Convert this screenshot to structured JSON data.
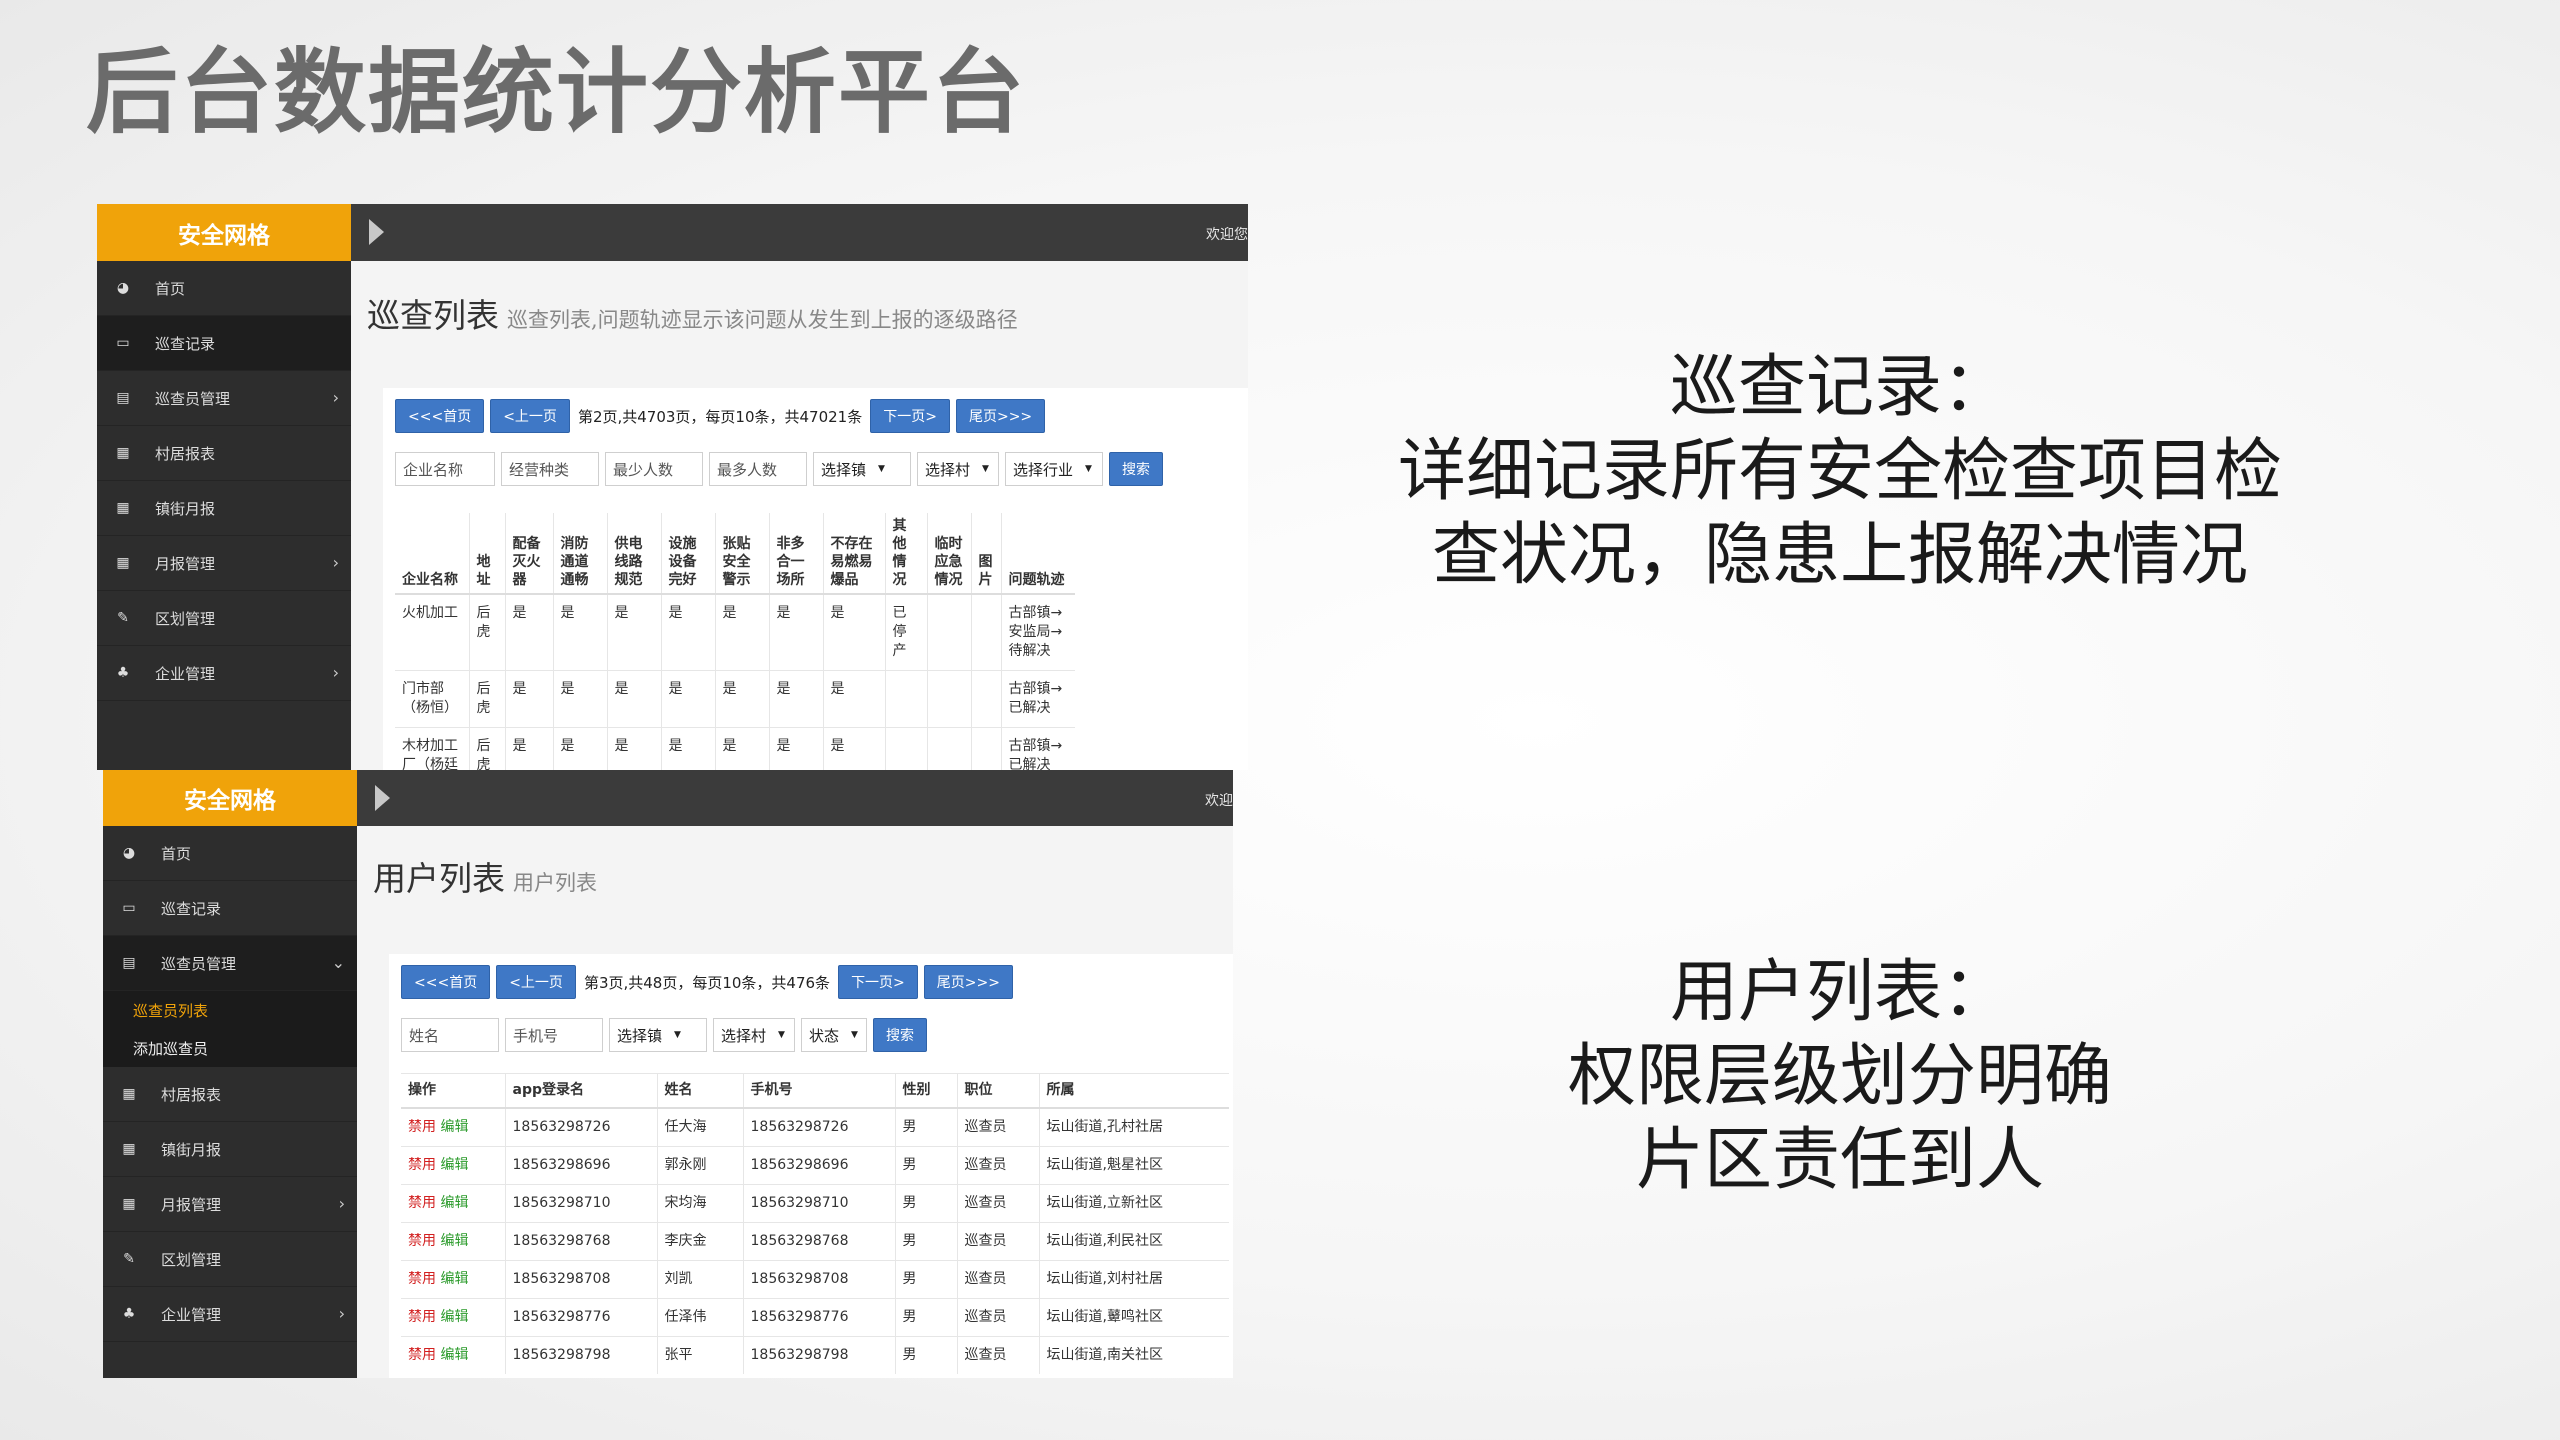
{
  "slide": {
    "title": "后台数据统计分析平台",
    "caption1": [
      "巡查记录：",
      "详细记录所有安全检查项目检",
      "查状况，隐患上报解决情况"
    ],
    "caption2": [
      "用户列表：",
      "权限层级划分明确",
      "片区责任到人"
    ]
  },
  "panel1": {
    "brand": "安全网格",
    "welcome": "欢迎您",
    "nav": [
      {
        "label": "首页",
        "icon": "dashboard-icon",
        "glyph": "◕"
      },
      {
        "label": "巡查记录",
        "icon": "desktop-icon",
        "glyph": "▭"
      },
      {
        "label": "巡查员管理",
        "icon": "chart-icon",
        "glyph": "▤",
        "arrow": "›"
      },
      {
        "label": "村居报表",
        "icon": "table-icon",
        "glyph": "▦"
      },
      {
        "label": "镇街月报",
        "icon": "table-icon",
        "glyph": "▦"
      },
      {
        "label": "月报管理",
        "icon": "table-icon",
        "glyph": "▦",
        "arrow": "›"
      },
      {
        "label": "区划管理",
        "icon": "edit-icon",
        "glyph": "✎"
      },
      {
        "label": "企业管理",
        "icon": "sitemap-icon",
        "glyph": "♣",
        "arrow": "›"
      }
    ],
    "page_title": "巡查列表",
    "page_subtitle": "巡查列表,问题轨迹显示该问题从发生到上报的逐级路径",
    "pager": {
      "first": "<<<首页",
      "prev": "<上一页",
      "info": "第2页,共4703页，每页10条，共47021条",
      "next": "下一页>",
      "last": "尾页>>>"
    },
    "filters": {
      "company_placeholder": "企业名称",
      "type_placeholder": "经营种类",
      "min_placeholder": "最少人数",
      "max_placeholder": "最多人数",
      "town": "选择镇",
      "village": "选择村",
      "industry": "选择行业",
      "search": "搜索"
    },
    "columns": [
      "企业名称",
      "地址",
      "配备灭火器",
      "消防通道通畅",
      "供电线路规范",
      "设施设备完好",
      "张贴安全警示",
      "非多合一场所",
      "不存在易燃易爆品",
      "其他情况",
      "临时应急情况",
      "图片",
      "问题轨迹"
    ],
    "rows": [
      [
        "火机加工",
        "后虎",
        "是",
        "是",
        "是",
        "是",
        "是",
        "是",
        "是",
        "已停产",
        "",
        "",
        "古部镇→安监局→待解决"
      ],
      [
        "门市部（杨恒）",
        "后虎",
        "是",
        "是",
        "是",
        "是",
        "是",
        "是",
        "是",
        "",
        "",
        "",
        "古部镇→已解决"
      ],
      [
        "木材加工厂（杨廷楼）",
        "后虎",
        "是",
        "是",
        "是",
        "是",
        "是",
        "是",
        "是",
        "",
        "",
        "",
        "古部镇→已解决"
      ]
    ]
  },
  "panel2": {
    "brand": "安全网格",
    "welcome": "欢迎",
    "nav": [
      {
        "label": "首页",
        "icon": "dashboard-icon",
        "glyph": "◕"
      },
      {
        "label": "巡查记录",
        "icon": "desktop-icon",
        "glyph": "▭"
      },
      {
        "label": "巡查员管理",
        "icon": "chart-icon",
        "glyph": "▤",
        "arrow": "⌄"
      }
    ],
    "subnav": [
      {
        "label": "巡查员列表",
        "current": true
      },
      {
        "label": "添加巡查员",
        "current": false
      }
    ],
    "nav_after": [
      {
        "label": "村居报表",
        "icon": "table-icon",
        "glyph": "▦"
      },
      {
        "label": "镇街月报",
        "icon": "table-icon",
        "glyph": "▦"
      },
      {
        "label": "月报管理",
        "icon": "table-icon",
        "glyph": "▦",
        "arrow": "›"
      },
      {
        "label": "区划管理",
        "icon": "edit-icon",
        "glyph": "✎"
      },
      {
        "label": "企业管理",
        "icon": "sitemap-icon",
        "glyph": "♣",
        "arrow": "›"
      }
    ],
    "page_title": "用户列表",
    "page_subtitle": "用户列表",
    "pager": {
      "first": "<<<首页",
      "prev": "<上一页",
      "info": "第3页,共48页，每页10条，共476条",
      "next": "下一页>",
      "last": "尾页>>>"
    },
    "filters": {
      "name_placeholder": "姓名",
      "phone_placeholder": "手机号",
      "town": "选择镇",
      "village": "选择村",
      "status": "状态",
      "search": "搜索"
    },
    "columns": [
      "操作",
      "app登录名",
      "姓名",
      "手机号",
      "性别",
      "职位",
      "所属"
    ],
    "ban_label": "禁用",
    "edit_label": "编辑",
    "rows": [
      [
        "18563298726",
        "任大海",
        "18563298726",
        "男",
        "巡查员",
        "坛山街道,孔村社居"
      ],
      [
        "18563298696",
        "郭永刚",
        "18563298696",
        "男",
        "巡查员",
        "坛山街道,魁星社区"
      ],
      [
        "18563298710",
        "宋均海",
        "18563298710",
        "男",
        "巡查员",
        "坛山街道,立新社区"
      ],
      [
        "18563298768",
        "李庆金",
        "18563298768",
        "男",
        "巡查员",
        "坛山街道,利民社区"
      ],
      [
        "18563298708",
        "刘凯",
        "18563298708",
        "男",
        "巡查员",
        "坛山街道,刘村社居"
      ],
      [
        "18563298776",
        "任泽伟",
        "18563298776",
        "男",
        "巡查员",
        "坛山街道,鼙鸣社区"
      ],
      [
        "18563298798",
        "张平",
        "18563298798",
        "男",
        "巡查员",
        "坛山街道,南关社区"
      ]
    ]
  }
}
